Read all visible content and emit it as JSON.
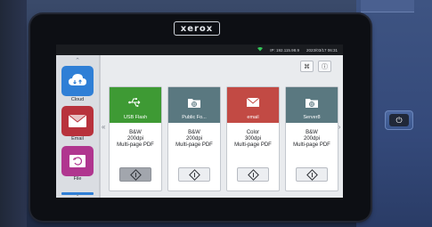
{
  "device": {
    "brand": "xerox",
    "power_symbol": "⏻"
  },
  "statusbar": {
    "ip": "IP: 192.115.98.9",
    "datetime": "2023/03/17 06:31",
    "wifi_icon": "wifi-icon"
  },
  "toolbar": {
    "reset_symbol": "⌘",
    "info_symbol": "ⓘ"
  },
  "apps": [
    {
      "label": "Cloud",
      "color": "#2f7fd6",
      "icon": "cloud-icon"
    },
    {
      "label": "Email",
      "color": "#b8323c",
      "icon": "envelope-icon"
    },
    {
      "label": "File",
      "color": "#b0368f",
      "icon": "file-icon"
    }
  ],
  "nav": {
    "up": "⌃",
    "down": "⌄",
    "prev": "«",
    "next": "»"
  },
  "tiles": [
    {
      "name": "USB Flash",
      "color": "#3e9a34",
      "mode": "B&W",
      "resolution": "200dpi",
      "format": "Multi-page PDF",
      "icon": "usb-icon"
    },
    {
      "name": "Public Fo...",
      "color": "#5a7880",
      "mode": "B&W",
      "resolution": "200dpi",
      "format": "Multi-page PDF",
      "icon": "folder-icon"
    },
    {
      "name": "email",
      "color": "#c24a44",
      "mode": "Color",
      "resolution": "300dpi",
      "format": "Multi-page PDF",
      "icon": "envelope-icon"
    },
    {
      "name": "Server8",
      "color": "#5a7880",
      "mode": "B&W",
      "resolution": "200dpi",
      "format": "Multi-page PDF",
      "icon": "server-folder-icon"
    }
  ]
}
